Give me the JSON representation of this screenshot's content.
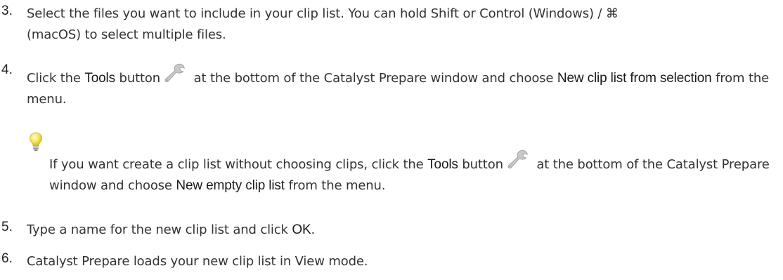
{
  "steps": [
    {
      "number": "3.",
      "line1": "Select the files you want to include in your clip list. You can hold Shift or Control (Windows) / ⌘",
      "line2": "(macOS) to select multiple files."
    },
    {
      "number": "4.",
      "prefix": "Click the ",
      "tools_label": "Tools",
      "middle": " at the bottom of the Catalyst Prepare window and choose ",
      "menu_item": "New clip list from selection",
      "suffix": " from the menu.",
      "icon": "wrench-icon"
    },
    {
      "number": "5.",
      "prefix": "Type a name for the new clip list and click ",
      "ok_label": "OK",
      "suffix": "."
    },
    {
      "number": "6.",
      "text": "Catalyst Prepare loads your new clip list in View mode."
    }
  ],
  "tip": {
    "icon": "lightbulb-icon",
    "prefix": "If you want create a clip list without choosing clips, click the ",
    "tools_label": "Tools",
    "middle": " at the bottom of the Catalyst Prepare window and choose ",
    "menu_item": "New empty clip list",
    "suffix": " from the menu."
  },
  "colors": {
    "text": "#333333",
    "bulb": "#f2e15a",
    "wrench": "#c9c9c9"
  }
}
